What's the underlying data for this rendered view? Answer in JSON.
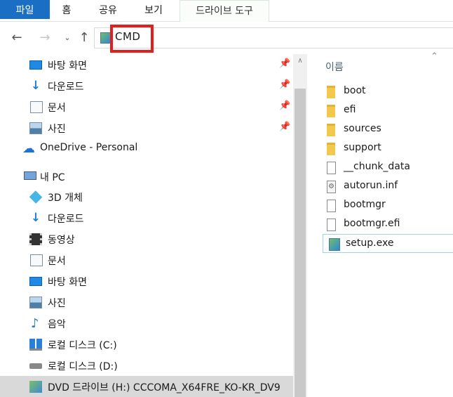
{
  "ribbon": {
    "tabs": [
      {
        "label": "파일"
      },
      {
        "label": "홈"
      },
      {
        "label": "공유"
      },
      {
        "label": "보기"
      },
      {
        "label": "드라이브 도구"
      }
    ]
  },
  "address": {
    "text": "CMD"
  },
  "nav": {
    "items": [
      {
        "label": "바탕 화면",
        "icon": "desktop-icon",
        "pinned": true
      },
      {
        "label": "다운로드",
        "icon": "download-icon",
        "pinned": true
      },
      {
        "label": "문서",
        "icon": "documents-icon",
        "pinned": true
      },
      {
        "label": "사진",
        "icon": "pictures-icon",
        "pinned": true
      },
      {
        "label": "OneDrive - Personal",
        "icon": "onedrive-icon"
      },
      {
        "label": "내 PC",
        "icon": "this-pc-icon"
      },
      {
        "label": "3D 개체",
        "icon": "3d-objects-icon"
      },
      {
        "label": "다운로드",
        "icon": "download-icon"
      },
      {
        "label": "동영상",
        "icon": "videos-icon"
      },
      {
        "label": "문서",
        "icon": "documents-icon"
      },
      {
        "label": "바탕 화면",
        "icon": "desktop-icon"
      },
      {
        "label": "사진",
        "icon": "pictures-icon"
      },
      {
        "label": "음악",
        "icon": "music-icon"
      },
      {
        "label": "로컬 디스크 (C:)",
        "icon": "windows-drive-icon"
      },
      {
        "label": "로컬 디스크 (D:)",
        "icon": "drive-icon"
      },
      {
        "label": "DVD 드라이브 (H:) CCCOMA_X64FRE_KO-KR_DV9",
        "icon": "dvd-drive-icon",
        "selected": true
      }
    ]
  },
  "content": {
    "column_header": "이름",
    "files": [
      {
        "name": "boot",
        "icon": "folder-icon"
      },
      {
        "name": "efi",
        "icon": "folder-icon"
      },
      {
        "name": "sources",
        "icon": "folder-icon"
      },
      {
        "name": "support",
        "icon": "folder-icon"
      },
      {
        "name": "__chunk_data",
        "icon": "file-icon"
      },
      {
        "name": "autorun.inf",
        "icon": "settings-file-icon"
      },
      {
        "name": "bootmgr",
        "icon": "file-icon"
      },
      {
        "name": "bootmgr.efi",
        "icon": "file-icon"
      },
      {
        "name": "setup.exe",
        "icon": "setup-exe-icon",
        "selected": true
      }
    ]
  },
  "colors": {
    "file_tab": "#1a6fc4",
    "highlight_box": "#e0201c",
    "selection": "#d9d9d9"
  }
}
